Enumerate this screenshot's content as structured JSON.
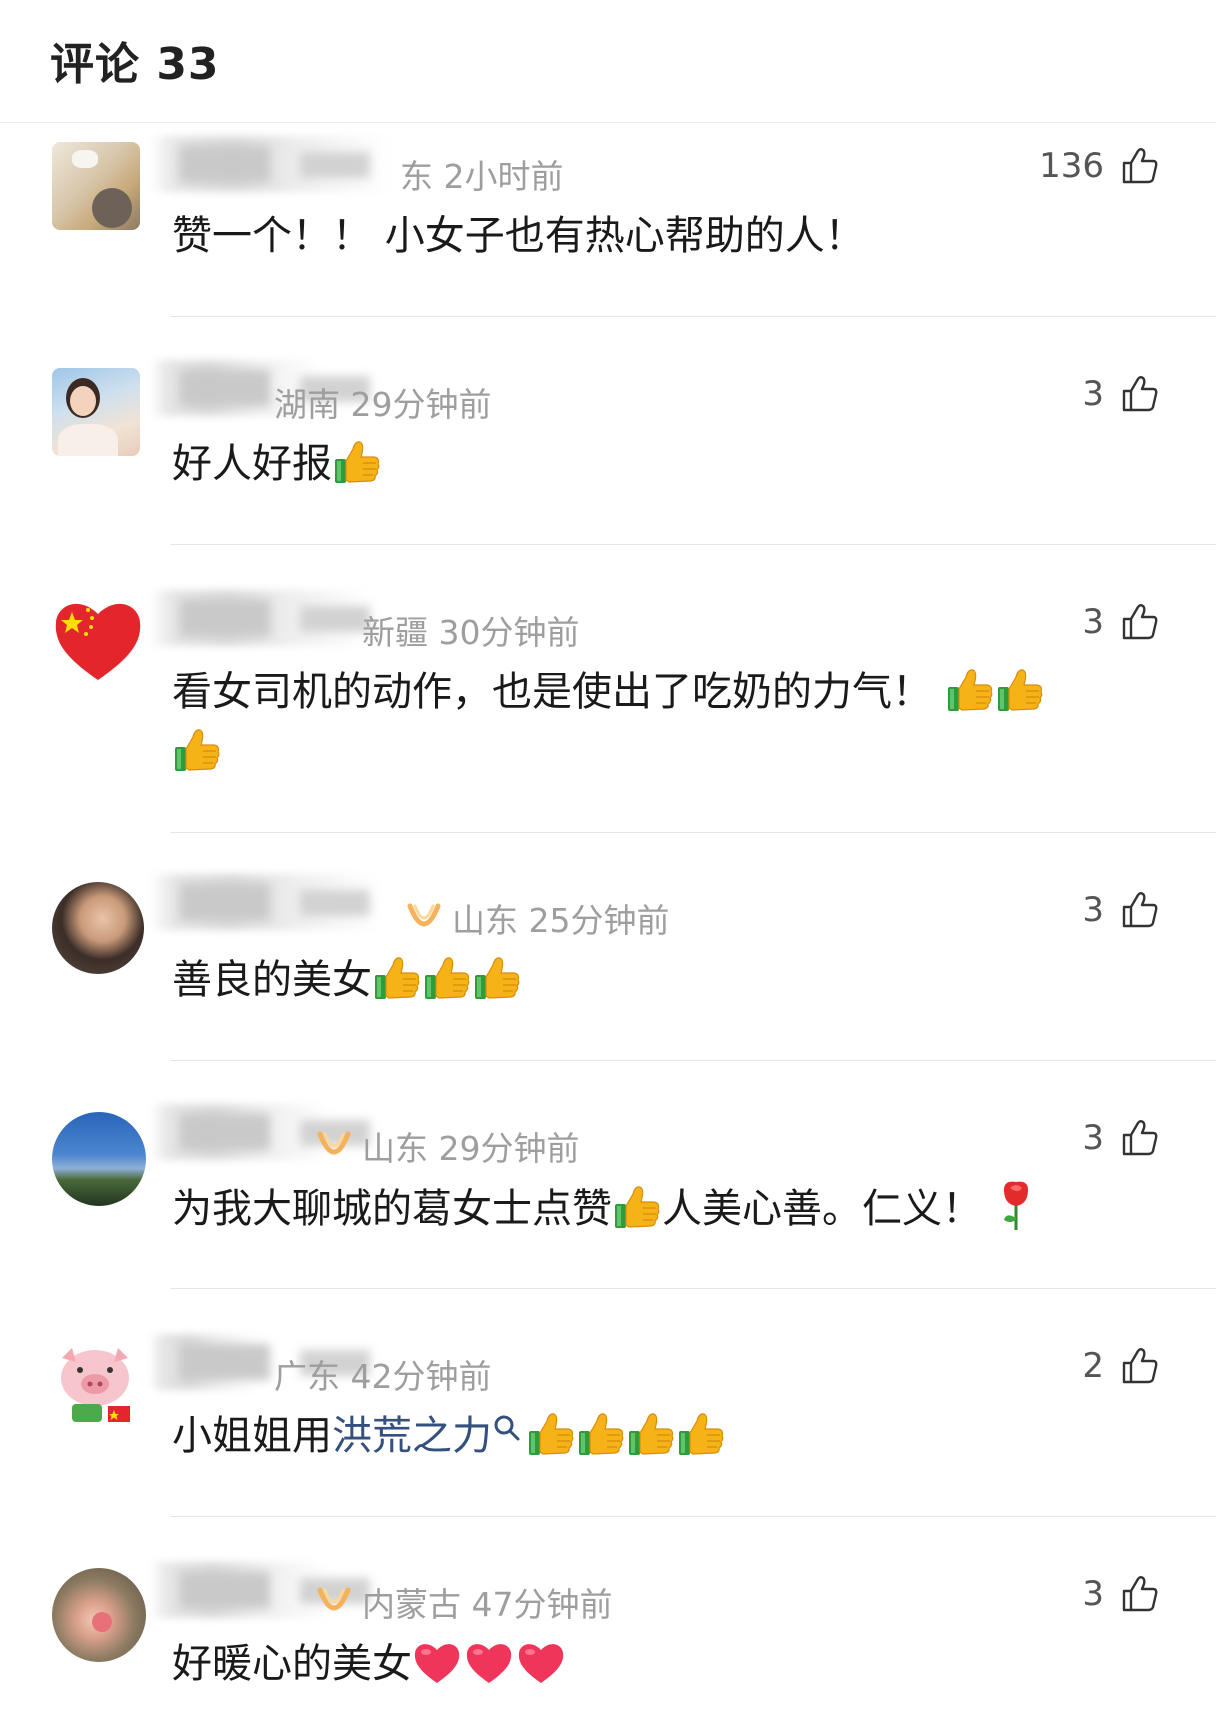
{
  "header": {
    "title": "评论 33"
  },
  "comments": [
    {
      "meta": "东 2小时前",
      "likes": "136",
      "text": "赞一个！！ 小女子也有热心帮助的人！"
    },
    {
      "meta": "湖南 29分钟前",
      "likes": "3",
      "text": "好人好报"
    },
    {
      "meta": "新疆 30分钟前",
      "likes": "3",
      "text": "看女司机的动作，也是使出了吃奶的力气！"
    },
    {
      "meta": "山东 25分钟前",
      "likes": "3",
      "text": "善良的美女"
    },
    {
      "meta": "山东 29分钟前",
      "likes": "3",
      "text": "为我大聊城的葛女士点赞",
      "text2": "人美心善。仁义！"
    },
    {
      "meta": "广东 42分钟前",
      "likes": "2",
      "text": "小姐姐用",
      "link": "洪荒之力"
    },
    {
      "meta": "内蒙古 47分钟前",
      "likes": "3",
      "text": "好暖心的美女"
    }
  ],
  "icons": {
    "like": "thumbs-up-outline-icon",
    "emoji": "thumbs-up-emoji",
    "heart": "red-heart-emoji",
    "rose": "rose-emoji",
    "badge": "gold-vip-badge-icon"
  },
  "colors": {
    "meta": "#9e9e9e",
    "link": "#33507e",
    "heart": "#f0355a",
    "thumb": "#f6b318"
  }
}
